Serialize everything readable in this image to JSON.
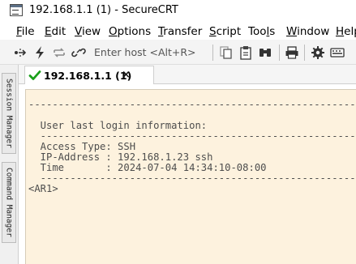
{
  "window": {
    "title": "192.168.1.1 (1) - SecureCRT"
  },
  "menu": [
    {
      "key": "F",
      "rest": "ile"
    },
    {
      "key": "E",
      "rest": "dit"
    },
    {
      "key": "V",
      "rest": "iew"
    },
    {
      "key": "O",
      "rest": "ptions"
    },
    {
      "key": "T",
      "rest": "ransfer"
    },
    {
      "key": "S",
      "rest": "cript"
    },
    {
      "pre": "Too",
      "key": "l",
      "rest": "s"
    },
    {
      "key": "W",
      "rest": "indow"
    },
    {
      "key": "H",
      "rest": "elp"
    }
  ],
  "toolbar": {
    "host_placeholder": "Enter host <Alt+R>",
    "icons": [
      "connect-icon",
      "quick-connect-icon",
      "reconnect-icon",
      "disconnect-icon",
      "copy-icon",
      "paste-icon",
      "find-icon",
      "print-icon",
      "settings-icon",
      "keymap-icon"
    ]
  },
  "side_tabs": {
    "session_manager": "Session Manager",
    "command_manager": "Command Manager"
  },
  "session_tab": {
    "label": "192.168.1.1 (1)",
    "close": "×",
    "status_color": "#1aa01a"
  },
  "terminal": {
    "background": "#fdf2de",
    "lines": [
      "-----------------------------------------------------------------",
      "",
      "  User last login information:",
      "  ---------------------------------------------------------------",
      "  Access Type: SSH",
      "  IP-Address : 192.168.1.23 ssh",
      "  Time       : 2024-07-04 14:34:10-08:00",
      "  ---------------------------------------------------------------",
      "<AR1>"
    ]
  }
}
